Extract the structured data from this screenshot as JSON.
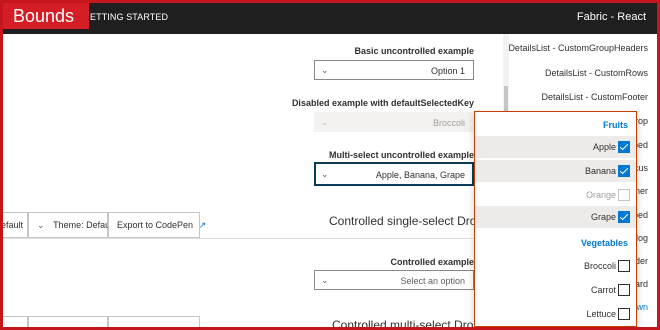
{
  "overlay": {
    "tag": "Bounds"
  },
  "header": {
    "nav_label": "ETTING STARTED",
    "app_title": "Fabric - React"
  },
  "examples": [
    {
      "label": "Basic uncontrolled example",
      "value": "Option 1"
    },
    {
      "label": "Disabled example with defaultSelectedKey",
      "value": "Broccoli"
    },
    {
      "label": "Multi-select uncontrolled example",
      "value": "Apple, Banana, Grape"
    }
  ],
  "toolbar": {
    "rtl_fragment": "efault",
    "theme_label": "Theme: Default",
    "codepen_label": "Export to CodePen"
  },
  "section1": {
    "title": "Controlled single-select Dropdown",
    "label": "Controlled example",
    "placeholder": "Select an option"
  },
  "section2": {
    "title": "Controlled multi-select Dropdown"
  },
  "nav": {
    "items": [
      {
        "label": "DetailsList - CustomGroupHeaders"
      },
      {
        "label": "DetailsList - CustomRows"
      },
      {
        "label": "DetailsList - CustomFooter"
      },
      {
        "label": "rop"
      },
      {
        "label": "ped"
      },
      {
        "label": "ocus"
      },
      {
        "label": "mer"
      },
      {
        "label": "ped"
      },
      {
        "label": "alog"
      },
      {
        "label": "ider"
      },
      {
        "label": "Card"
      },
      {
        "label": "own"
      }
    ]
  },
  "popup": {
    "group1": "Fruits",
    "group2": "Vegetables",
    "options": [
      {
        "label": "Apple",
        "checked": true
      },
      {
        "label": "Banana",
        "checked": true
      },
      {
        "label": "Orange",
        "checked": false,
        "disabled": true
      },
      {
        "label": "Grape",
        "checked": true
      },
      {
        "label": "Broccoli",
        "checked": false
      },
      {
        "label": "Carrot",
        "checked": false
      },
      {
        "label": "Lettuce",
        "checked": false
      }
    ]
  },
  "colors": {
    "accent": "#0078d4",
    "header_bg": "#1f1f1f",
    "overlay_red": "#d41d25"
  },
  "icons": {
    "chevron": "chevron-down-icon",
    "popout": "open-in-new-window-icon"
  }
}
